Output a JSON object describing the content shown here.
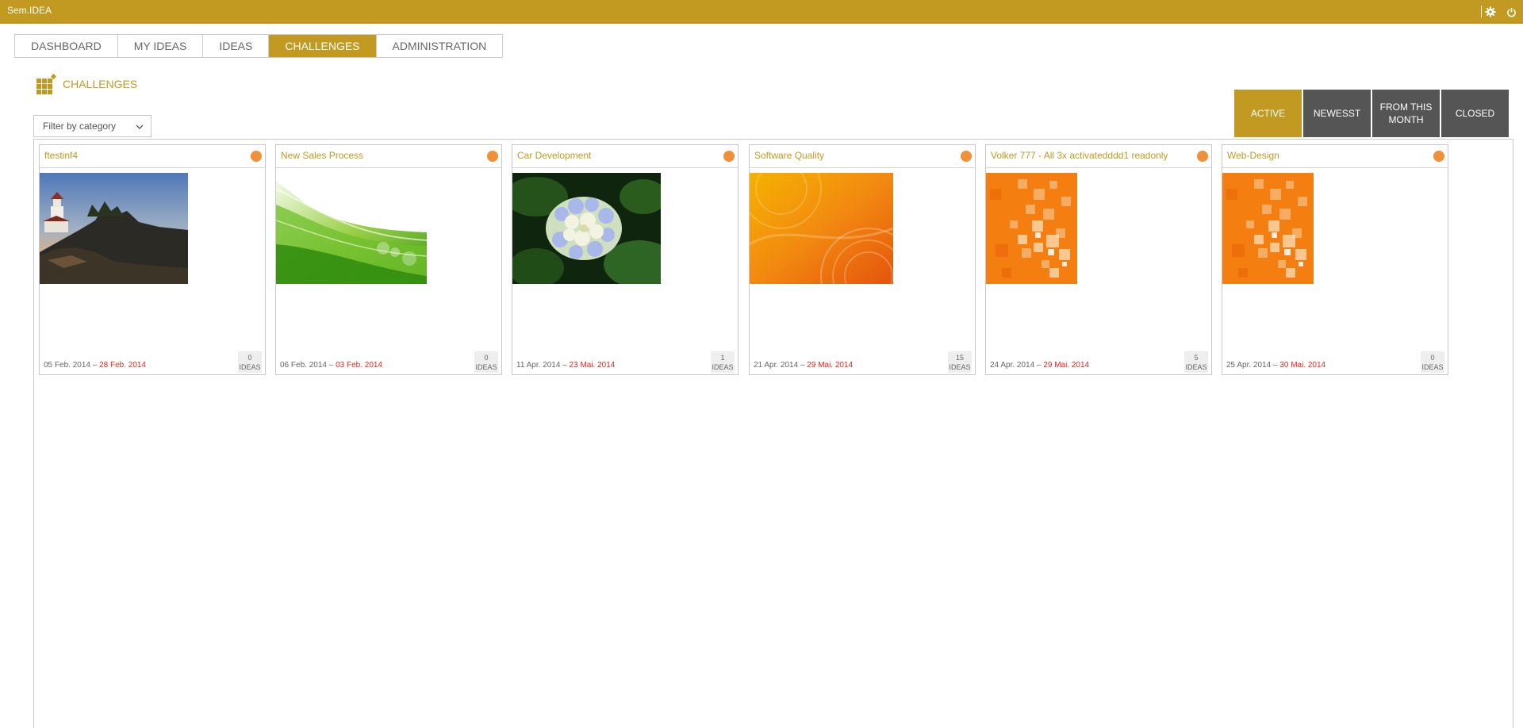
{
  "app": {
    "title": "Sem.IDEA"
  },
  "nav": {
    "tabs": [
      {
        "label": "DASHBOARD"
      },
      {
        "label": "MY IDEAS"
      },
      {
        "label": "IDEAS"
      },
      {
        "label": "CHALLENGES",
        "active": true
      },
      {
        "label": "ADMINISTRATION"
      }
    ]
  },
  "page": {
    "title": "CHALLENGES"
  },
  "filter": {
    "placeholder": "Filter by category"
  },
  "view_buttons": [
    {
      "label": "ACTIVE",
      "active": true
    },
    {
      "label": "NEWESST"
    },
    {
      "label": "FROM THIS MONTH"
    },
    {
      "label": "CLOSED"
    }
  ],
  "challenges": [
    {
      "title": "ftestinf4",
      "start": "05 Feb. 2014",
      "sep": "–",
      "end": "28 Feb. 2014",
      "ideas_count": "0",
      "ideas_label": "IDEAS",
      "image": "lighthouse"
    },
    {
      "title": "New Sales Process",
      "start": "06 Feb. 2014",
      "sep": "–",
      "end": "03 Feb. 2014",
      "ideas_count": "0",
      "ideas_label": "IDEAS",
      "image": "green-waves"
    },
    {
      "title": "Car Development",
      "start": "11 Apr. 2014",
      "sep": "–",
      "end": "23 Mai. 2014",
      "ideas_count": "1",
      "ideas_label": "IDEAS",
      "image": "hydrangea-flower"
    },
    {
      "title": "Software Quality",
      "start": "21 Apr. 2014",
      "sep": "–",
      "end": "29 Mai. 2014",
      "ideas_count": "15",
      "ideas_label": "IDEAS",
      "image": "orange-swirls"
    },
    {
      "title": "Volker 777 - All 3x activatedddd1 readonly",
      "start": "24 Apr. 2014",
      "sep": "–",
      "end": "29 Mai. 2014",
      "ideas_count": "5",
      "ideas_label": "IDEAS",
      "image": "orange-squares"
    },
    {
      "title": "Web-Design",
      "start": "25 Apr. 2014",
      "sep": "–",
      "end": "30 Mai. 2014",
      "ideas_count": "0",
      "ideas_label": "IDEAS",
      "image": "orange-squares"
    }
  ],
  "colors": {
    "brand": "#c29a22",
    "date_end": "#e3281d",
    "status_dot": "#f0913a",
    "inactive_button": "#555555"
  },
  "icons": [
    "settings-gear-icon",
    "power-icon",
    "grid-icon",
    "chevron-down-icon",
    "status-dot-icon"
  ]
}
